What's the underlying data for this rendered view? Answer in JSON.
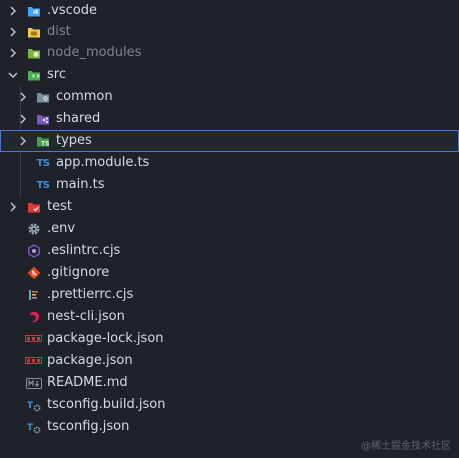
{
  "explorer": {
    "items": [
      {
        "label": ".vscode",
        "kind": "folder",
        "icon": "vscode-folder-icon",
        "expanded": false
      },
      {
        "label": "dist",
        "kind": "folder",
        "icon": "dist-folder-icon",
        "expanded": false
      },
      {
        "label": "node_modules",
        "kind": "folder",
        "icon": "node-modules-folder-icon",
        "expanded": false,
        "dimmed": true
      },
      {
        "label": "src",
        "kind": "folder",
        "icon": "src-folder-icon",
        "expanded": true
      },
      {
        "label": "common",
        "kind": "folder",
        "icon": "common-folder-icon",
        "expanded": false
      },
      {
        "label": "shared",
        "kind": "folder",
        "icon": "shared-folder-icon",
        "expanded": false
      },
      {
        "label": "types",
        "kind": "folder",
        "icon": "types-folder-icon",
        "expanded": false,
        "selected": true
      },
      {
        "label": "app.module.ts",
        "kind": "file",
        "icon": "typescript-file-icon",
        "icon_text": "TS"
      },
      {
        "label": "main.ts",
        "kind": "file",
        "icon": "typescript-file-icon",
        "icon_text": "TS"
      },
      {
        "label": "test",
        "kind": "folder",
        "icon": "test-folder-icon",
        "expanded": false
      },
      {
        "label": ".env",
        "kind": "file",
        "icon": "gear-icon"
      },
      {
        "label": ".eslintrc.cjs",
        "kind": "file",
        "icon": "eslint-icon"
      },
      {
        "label": ".gitignore",
        "kind": "file",
        "icon": "git-icon"
      },
      {
        "label": ".prettierrc.cjs",
        "kind": "file",
        "icon": "prettier-icon"
      },
      {
        "label": "nest-cli.json",
        "kind": "file",
        "icon": "nestjs-icon"
      },
      {
        "label": "package-lock.json",
        "kind": "file",
        "icon": "npm-icon"
      },
      {
        "label": "package.json",
        "kind": "file",
        "icon": "npm-icon"
      },
      {
        "label": "README.md",
        "kind": "file",
        "icon": "markdown-icon"
      },
      {
        "label": "tsconfig.build.json",
        "kind": "file",
        "icon": "tsconfig-icon"
      },
      {
        "label": "tsconfig.json",
        "kind": "file",
        "icon": "tsconfig-icon"
      }
    ]
  },
  "watermark": "@稀土掘金技术社区",
  "colors": {
    "background": "#1f2329",
    "selection_border": "#4d78cc",
    "text": "#d7dae0",
    "dim_text": "#7f848e"
  }
}
